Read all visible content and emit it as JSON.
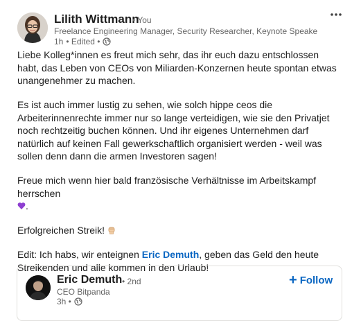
{
  "post": {
    "author": {
      "name": "Lilith Wittmann",
      "degree": "• You",
      "headline": "Freelance Engineering Manager, Security Researcher, Keynote Speaker, ...",
      "time": "1h",
      "edited": "• Edited •",
      "visibility_icon": "globe-icon"
    },
    "more_icon": "more-horizontal-icon",
    "paragraphs": {
      "p1": "Liebe Kolleg*innen es freut mich sehr, das ihr euch dazu entschlossen habt, das Leben von CEOs von Miliarden-Konzernen heute spontan etwas unangenehmer zu machen.",
      "p2": "Es ist auch immer lustig zu sehen, wie solch hippe ceos die Arbeiterinnenrechte immer nur so lange verteidigen, wie sie den Privatjet noch rechtzeitig buchen können. Und ihr eigenes Unternehmen darf natürlich auf keinen Fall gewerkschaftlich organisiert werden - weil was sollen denn dann die armen Investoren sagen!",
      "p3": "Freue mich wenn hier bald französische Verhältnisse im Arbeitskampf herrschen",
      "p3_end": ".",
      "p4": "Erfolgreichen Streik!",
      "p5_before": "Edit: Ich habs, wir enteignen ",
      "p5_mention": "Eric Demuth",
      "p5_after": ", geben das Geld den heute Streikenden und alle kommen in den Urlaub!"
    },
    "emoji": {
      "heart": "purple-heart-icon",
      "fist": "raised-fist-icon",
      "heart_color": "#8e3fd1"
    },
    "shared": {
      "name": "Eric Demuth",
      "degree": "• 2nd",
      "title": "CEO Bitpanda",
      "time": "3h •",
      "visibility_icon": "globe-icon",
      "follow_label": "Follow",
      "follow_icon": "plus-icon"
    }
  },
  "colors": {
    "link": "#0a66c2",
    "text": "#1d1d1d",
    "secondary": "#666666"
  }
}
